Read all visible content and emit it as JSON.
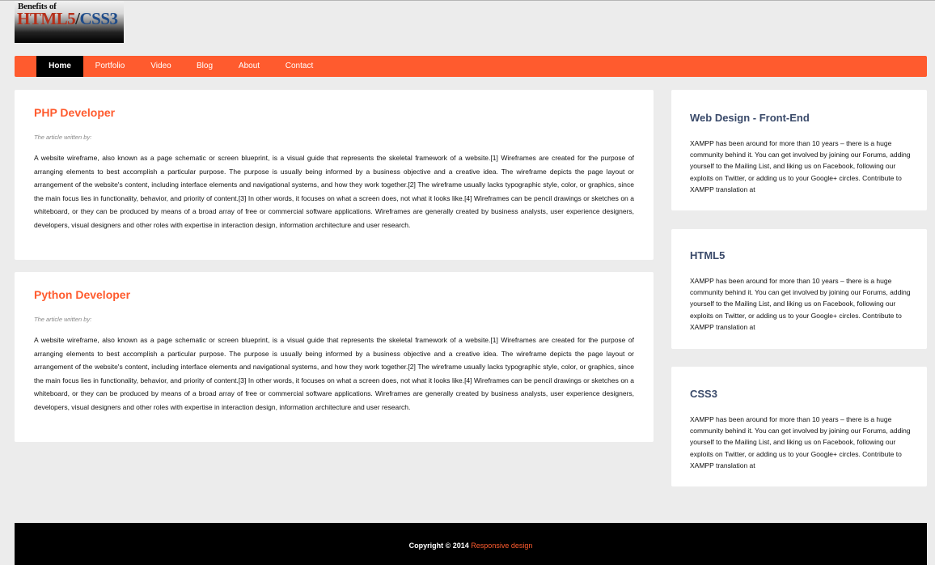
{
  "header": {
    "logo": {
      "top_text": "Benefits of",
      "html5": "HTML5",
      "slash": "/",
      "css3": "CSS3"
    }
  },
  "nav": {
    "items": [
      {
        "label": "Home",
        "active": true
      },
      {
        "label": "Portfolio",
        "active": false
      },
      {
        "label": "Video",
        "active": false
      },
      {
        "label": "Blog",
        "active": false
      },
      {
        "label": "About",
        "active": false
      },
      {
        "label": "Contact",
        "active": false
      }
    ]
  },
  "articles": [
    {
      "title": "PHP Developer",
      "byline": "The article written by:",
      "body": "A website wireframe, also known as a page schematic or screen blueprint, is a visual guide that represents the skeletal framework of a website.[1] Wireframes are created for the purpose of arranging elements to best accomplish a particular purpose. The purpose is usually being informed by a business objective and a creative idea. The wireframe depicts the page layout or arrangement of the website's content, including interface elements and navigational systems, and how they work together.[2] The wireframe usually lacks typographic style, color, or graphics, since the main focus lies in functionality, behavior, and priority of content.[3] In other words, it focuses on what a screen does, not what it looks like.[4] Wireframes can be pencil drawings or sketches on a whiteboard, or they can be produced by means of a broad array of free or commercial software applications. Wireframes are generally created by business analysts, user experience designers, developers, visual designers and other roles with expertise in interaction design, information architecture and user research."
    },
    {
      "title": "Python Developer",
      "byline": "The article written by:",
      "body": "A website wireframe, also known as a page schematic or screen blueprint, is a visual guide that represents the skeletal framework of a website.[1] Wireframes are created for the purpose of arranging elements to best accomplish a particular purpose. The purpose is usually being informed by a business objective and a creative idea. The wireframe depicts the page layout or arrangement of the website's content, including interface elements and navigational systems, and how they work together.[2] The wireframe usually lacks typographic style, color, or graphics, since the main focus lies in functionality, behavior, and priority of content.[3] In other words, it focuses on what a screen does, not what it looks like.[4] Wireframes can be pencil drawings or sketches on a whiteboard, or they can be produced by means of a broad array of free or commercial software applications. Wireframes are generally created by business analysts, user experience designers, developers, visual designers and other roles with expertise in interaction design, information architecture and user research."
    }
  ],
  "sidebar": {
    "widgets": [
      {
        "title": "Web Design - Front-End",
        "body": "XAMPP has been around for more than 10 years – there is a huge community behind it. You can get involved by joining our Forums, adding yourself to the Mailing List, and liking us on Facebook, following our exploits on Twitter, or adding us to your Google+ circles. Contribute to XAMPP translation at"
      },
      {
        "title": "HTML5",
        "body": "XAMPP has been around for more than 10 years – there is a huge community behind it. You can get involved by joining our Forums, adding yourself to the Mailing List, and liking us on Facebook, following our exploits on Twitter, or adding us to your Google+ circles. Contribute to XAMPP translation at"
      },
      {
        "title": "CSS3",
        "body": "XAMPP has been around for more than 10 years – there is a huge community behind it. You can get involved by joining our Forums, adding yourself to the Mailing List, and liking us on Facebook, following our exploits on Twitter, or adding us to your Google+ circles. Contribute to XAMPP translation at"
      }
    ]
  },
  "footer": {
    "copyright": "Copyright © 2014",
    "link_label": "Responsive design"
  },
  "colors": {
    "accent": "#ff5b2e",
    "background": "#ececec",
    "nav_active": "#000000",
    "sidebar_title": "#3a4a6a"
  }
}
